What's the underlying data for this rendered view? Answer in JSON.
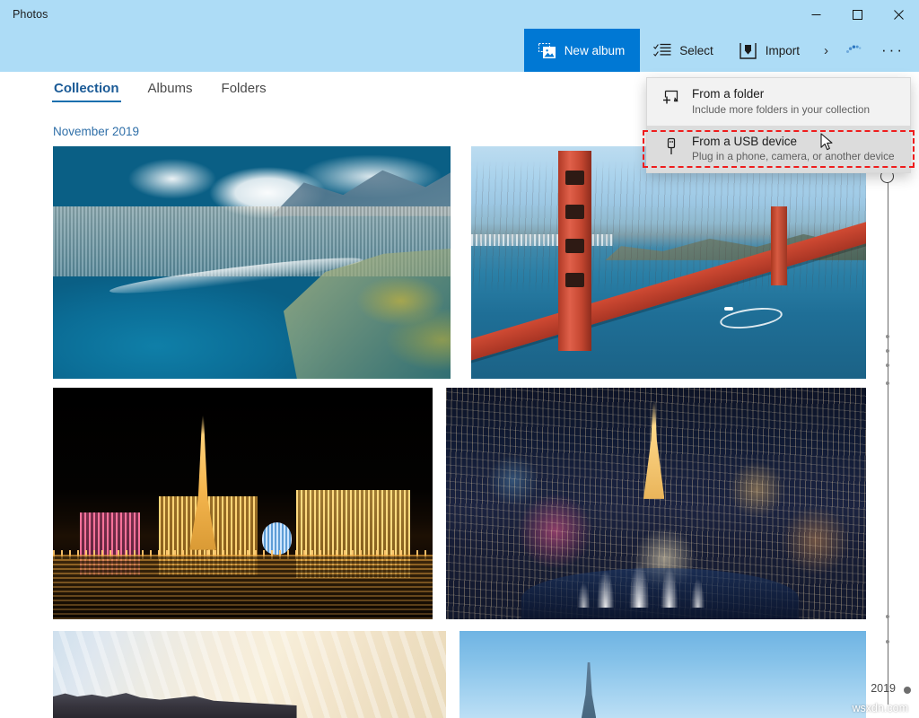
{
  "window": {
    "app_title": "Photos",
    "titlebar_color": "#addcf6",
    "accent_color": "#0078d4",
    "controls": {
      "minimize": "Minimize",
      "maximize": "Maximize",
      "close": "Close"
    }
  },
  "toolbar": {
    "new_album": {
      "label": "New album",
      "icon": "new-album-icon"
    },
    "select": {
      "label": "Select",
      "icon": "select-icon"
    },
    "import": {
      "label": "Import",
      "icon": "import-icon"
    },
    "overflow_chevron": {
      "label": "›",
      "icon": "chevron-right-icon"
    },
    "spinner": {
      "icon": "loading-spinner-icon"
    },
    "more": {
      "label": "···",
      "icon": "more-ellipsis-icon"
    }
  },
  "tabs": [
    {
      "label": "Collection",
      "active": true
    },
    {
      "label": "Albums",
      "active": false
    },
    {
      "label": "Folders",
      "active": false
    }
  ],
  "gallery": {
    "date_header": "November 2019",
    "photos": [
      {
        "name": "aerial-coastline-honolulu",
        "alt": "Aerial view of Honolulu coastline with clouds"
      },
      {
        "name": "golden-gate-bridge",
        "alt": "Golden Gate Bridge over the bay"
      },
      {
        "name": "las-vegas-paris-night",
        "alt": "Las Vegas Paris hotel at night reflected in water"
      },
      {
        "name": "las-vegas-strip-aerial",
        "alt": "Aerial view of Las Vegas strip at night with fountains"
      },
      {
        "name": "paris-cathedral-clouds",
        "alt": "Cathedral rooftop under cirrus clouds"
      },
      {
        "name": "eiffel-tower-blue-sky",
        "alt": "Eiffel tower against a blue sky"
      }
    ]
  },
  "import_menu": {
    "items": [
      {
        "title": "From a folder",
        "subtitle": "Include more folders in your collection",
        "icon": "folder-add-icon",
        "highlighted": false
      },
      {
        "title": "From a USB device",
        "subtitle": "Plug in a phone, camera, or another device",
        "icon": "usb-device-icon",
        "highlighted": true
      }
    ]
  },
  "annotation": {
    "highlight_color": "#ef1c1c",
    "style": "dashed-rectangle",
    "targets": "From a USB device"
  },
  "scrubber": {
    "year_label": "2019",
    "handle_position_pct": 2
  },
  "watermark": "wsxdn.com"
}
